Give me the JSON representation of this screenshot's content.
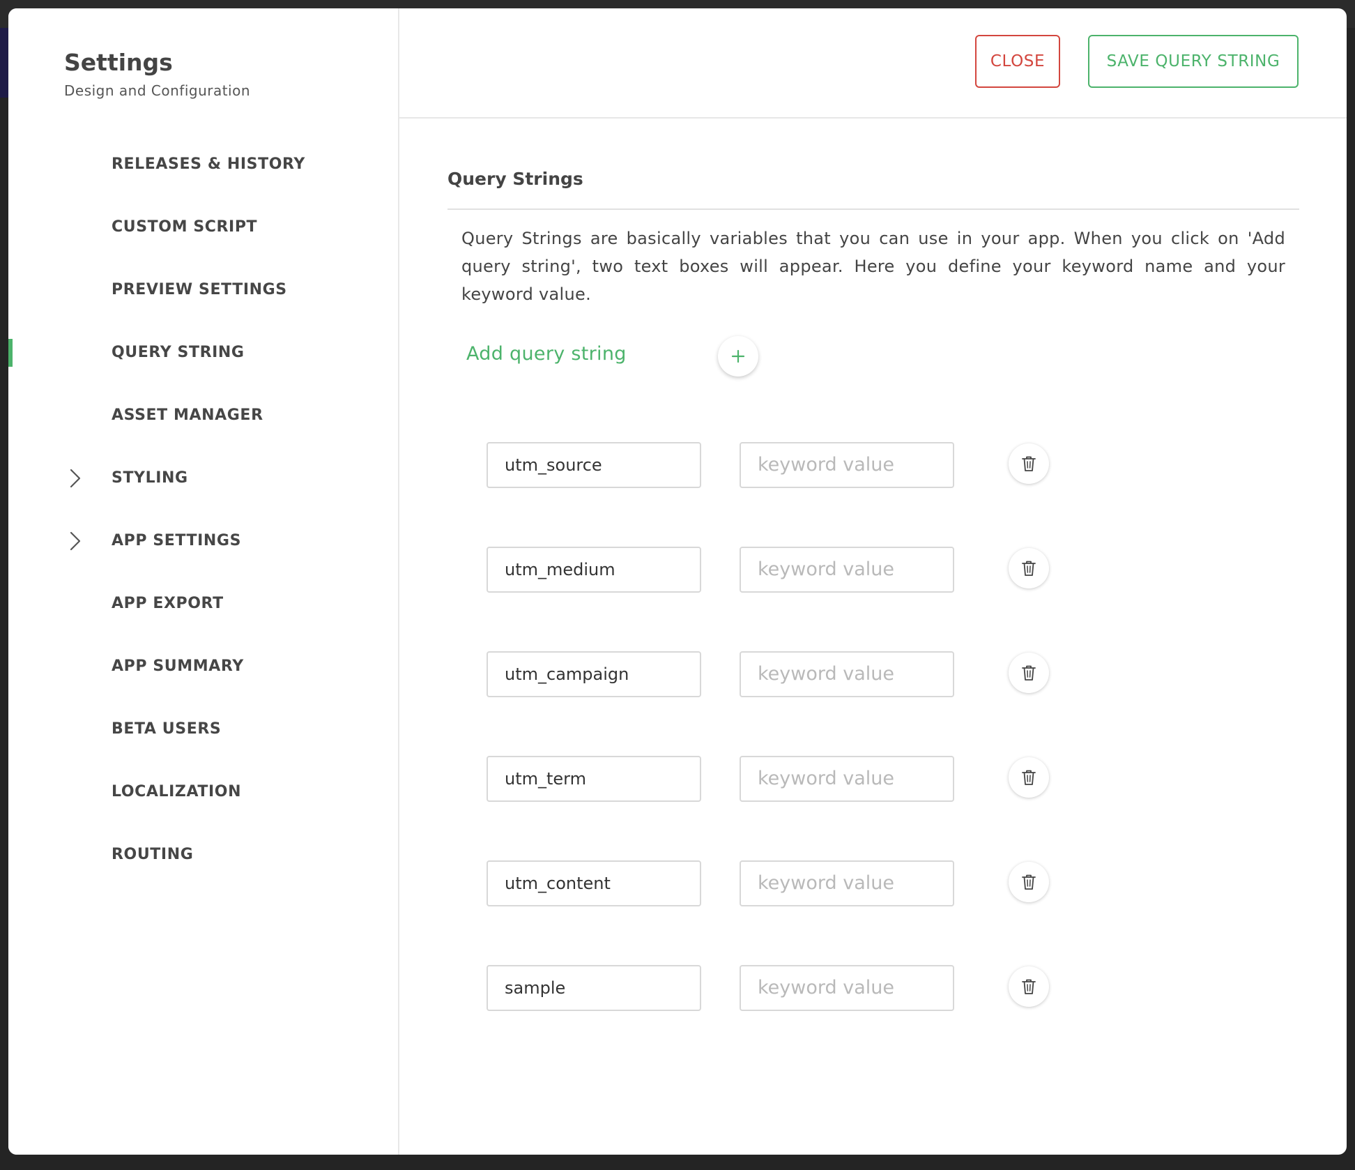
{
  "sidebar": {
    "title": "Settings",
    "subtitle": "Design and Configuration",
    "items": [
      {
        "label": "RELEASES & HISTORY",
        "expandable": false,
        "active": false
      },
      {
        "label": "CUSTOM SCRIPT",
        "expandable": false,
        "active": false
      },
      {
        "label": "PREVIEW SETTINGS",
        "expandable": false,
        "active": false
      },
      {
        "label": "QUERY STRING",
        "expandable": false,
        "active": true
      },
      {
        "label": "ASSET MANAGER",
        "expandable": false,
        "active": false
      },
      {
        "label": "STYLING",
        "expandable": true,
        "active": false
      },
      {
        "label": "APP SETTINGS",
        "expandable": true,
        "active": false
      },
      {
        "label": "APP EXPORT",
        "expandable": false,
        "active": false
      },
      {
        "label": "APP SUMMARY",
        "expandable": false,
        "active": false
      },
      {
        "label": "BETA USERS",
        "expandable": false,
        "active": false
      },
      {
        "label": "LOCALIZATION",
        "expandable": false,
        "active": false
      },
      {
        "label": "ROUTING",
        "expandable": false,
        "active": false
      }
    ]
  },
  "toolbar": {
    "close_label": "CLOSE",
    "save_label": "SAVE QUERY STRING"
  },
  "main": {
    "section_title": "Query Strings",
    "description": "Query Strings are basically variables that you can use in your app. When you click on 'Add query string', two text boxes will appear. Here you define your keyword name and your keyword value.",
    "add_label": "Add query string",
    "query_strings": [
      {
        "name": "utm_source",
        "value": "",
        "value_placeholder": "keyword value"
      },
      {
        "name": "utm_medium",
        "value": "",
        "value_placeholder": "keyword value"
      },
      {
        "name": "utm_campaign",
        "value": "",
        "value_placeholder": "keyword value"
      },
      {
        "name": "utm_term",
        "value": "",
        "value_placeholder": "keyword value"
      },
      {
        "name": "utm_content",
        "value": "",
        "value_placeholder": "keyword value"
      },
      {
        "name": "sample",
        "value": "",
        "value_placeholder": "keyword value"
      }
    ]
  },
  "icons": {
    "add": "plus-icon",
    "delete": "trash-icon",
    "expand": "chevron-right-icon"
  },
  "colors": {
    "accent": "#4cb36b",
    "danger": "#d3463e"
  }
}
